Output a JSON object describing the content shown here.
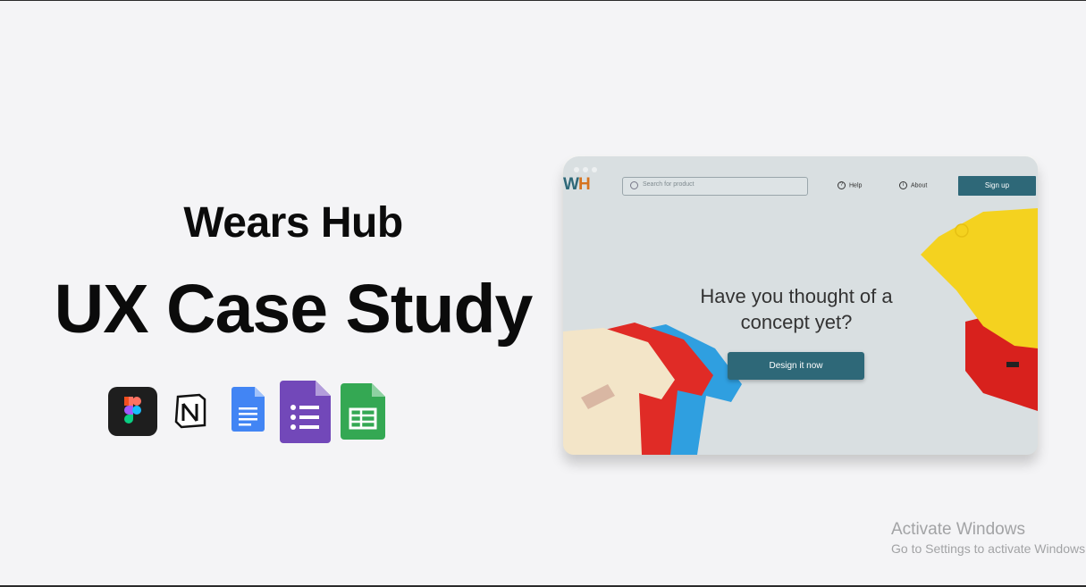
{
  "slide": {
    "brand_title": "Wears Hub",
    "main_title": "UX Case Study",
    "tools": [
      {
        "icon": "figma-icon"
      },
      {
        "icon": "notion-icon"
      },
      {
        "icon": "google-docs-icon"
      },
      {
        "icon": "google-forms-icon"
      },
      {
        "icon": "google-sheets-icon"
      }
    ]
  },
  "mockup": {
    "logo_w": "W",
    "logo_h": "H",
    "search_placeholder": "Search for product",
    "nav_help": "Help",
    "nav_about": "About",
    "signup_label": "Sign up",
    "hero_text": "Have you thought of a concept yet?",
    "cta_label": "Design it now",
    "colors": {
      "accent": "#2e6878",
      "logo_h": "#d6731f"
    }
  },
  "watermark": {
    "title": "Activate Windows",
    "subtitle": "Go to Settings to activate Windows."
  }
}
